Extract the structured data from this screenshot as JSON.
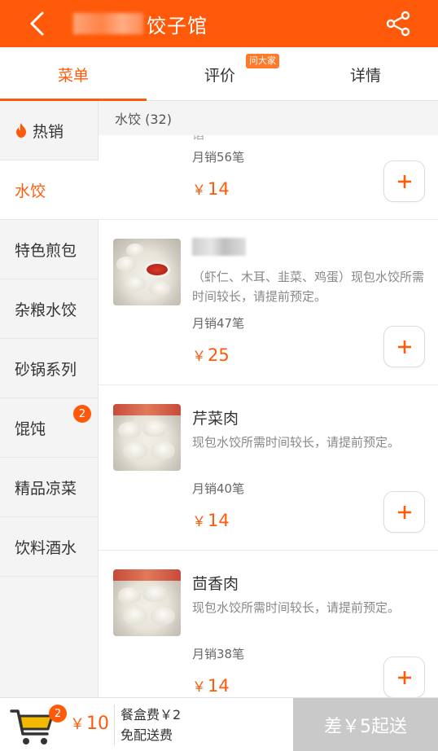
{
  "header": {
    "title": "饺子馆",
    "back_icon": "back-arrow-icon",
    "share_icon": "share-icon",
    "bg_color": "#ff5a0a"
  },
  "tabs": [
    {
      "label": "菜单",
      "active": true
    },
    {
      "label": "评价",
      "badge": "问大家"
    },
    {
      "label": "详情"
    }
  ],
  "sidebar": {
    "items": [
      {
        "label": "热销",
        "icon": "fire-icon"
      },
      {
        "label": "水饺",
        "active": true
      },
      {
        "label": "特色煎包"
      },
      {
        "label": "杂粮水饺"
      },
      {
        "label": "砂锅系列"
      },
      {
        "label": "馄饨",
        "badge": "2"
      },
      {
        "label": "精品凉菜"
      },
      {
        "label": "饮料酒水"
      }
    ]
  },
  "section": {
    "title": "水饺 (32)"
  },
  "items": [
    {
      "name": "",
      "partial_text": "馅",
      "sales": "月销56笔",
      "price": "14"
    },
    {
      "name": "",
      "desc": "（虾仁、木耳、韭菜、鸡蛋）现包水饺所需时间较长，请提前预定。",
      "sales": "月销47笔",
      "price": "25"
    },
    {
      "name": "芹菜肉",
      "desc": "现包水饺所需时间较长，请提前预定。",
      "sales": "月销40笔",
      "price": "14"
    },
    {
      "name": "茴香肉",
      "desc": "现包水饺所需时间较长，请提前预定。",
      "sales": "月销38笔",
      "price": "14"
    }
  ],
  "currency": "￥",
  "bottom": {
    "cart_count": "2",
    "total": "10",
    "box_fee": "餐盒费￥2",
    "delivery": "免配送费",
    "checkout_label": "差￥5起送"
  },
  "accent_color": "#ff5a0a"
}
